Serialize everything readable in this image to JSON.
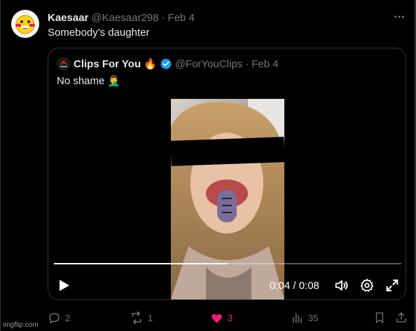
{
  "tweet": {
    "display_name": "Kaesaar",
    "handle": "@Kaesaar298",
    "separator": "·",
    "date": "Feb 4",
    "text": "Somebody's daughter"
  },
  "quote": {
    "display_name": "Clips For You",
    "name_emoji": "🔥",
    "verified": true,
    "handle": "@ForYouClips",
    "separator": "·",
    "date": "Feb 4",
    "text": "No shame",
    "text_emoji": "🤦‍♂️"
  },
  "video": {
    "time": "0:04 / 0:08",
    "progress": 0.5
  },
  "actions": {
    "reply_count": "2",
    "repost_count": "1",
    "like_count": "3",
    "views_count": "35"
  },
  "colors": {
    "background": "#000000",
    "border": "#2f3336",
    "text": "#e7e9ea",
    "muted": "#71767b",
    "verified_blue": "#1d9bf0",
    "like_pink": "#f91880"
  },
  "watermark": "imgflip.com"
}
